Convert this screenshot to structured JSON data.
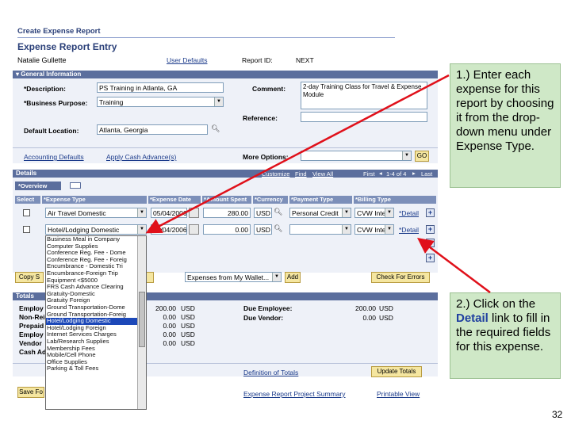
{
  "header": {
    "create_link": "Create Expense Report",
    "title": "Expense Report Entry",
    "user_name": "Natalie Gullette",
    "user_defaults": "User Defaults",
    "report_id_label": "Report ID:",
    "report_id_value": "NEXT"
  },
  "general": {
    "section_title": "General Information",
    "description_label": "*Description:",
    "description_value": "PS Training in Atlanta, GA",
    "purpose_label": "*Business Purpose:",
    "purpose_value": "Training",
    "comment_label": "Comment:",
    "comment_value": "2-day Training Class for Travel & Expense Module",
    "reference_label": "Reference:",
    "location_label": "Default Location:",
    "location_value": "Atlanta, Georgia",
    "accounting_defaults": "Accounting Defaults",
    "apply_cash_advance": "Apply Cash Advance(s)",
    "more_options_label": "More Options:",
    "go_button": "GO"
  },
  "details": {
    "section_title": "Details",
    "customize": "Customize",
    "find": "Find",
    "view_all": "View All",
    "first": "First",
    "range": "1-4 of 4",
    "last": "Last",
    "tab_overview": "*Overview",
    "columns": [
      "Select",
      "*Expense Type",
      "*Expense Date",
      "*Amount Spent",
      "*Currency",
      "*Payment Type",
      "*Billing Type"
    ],
    "rows": [
      {
        "type": "Air Travel Domestic",
        "date": "05/04/2006",
        "amount": "280.00",
        "currency": "USD",
        "payment": "Personal Credit",
        "billing": "CVW Inte",
        "detail": "*Detail"
      },
      {
        "type": "Hotel/Lodging Domestic",
        "date": "05/04/2006",
        "amount": "0.00",
        "currency": "USD",
        "payment": "",
        "billing": "CVW Inte",
        "detail": "*Detail"
      }
    ],
    "copy_selected": "Copy S",
    "wallet_select": "Expenses from My Wallet...",
    "add_button": "Add",
    "check_errors": "Check For Errors"
  },
  "dropdown": {
    "items": [
      "Business Meal in Company",
      "Computer Supplies",
      "Conference Reg. Fee - Dome",
      "Conference Reg. Fee - Foreig",
      "Encumbrance - Domestic Tri",
      "Encumbrance-Foreign Trip",
      "Equipment <$5000",
      "FRS Cash Advance Clearing",
      "Gratuity-Domestic",
      "Gratuity Foreign",
      "Ground Transportation-Dome",
      "Ground Transportation-Foreig",
      "Hotel/Lodging Domestic",
      "Hotel/Lodging Foreign",
      "Internet Services Charges",
      "Lab/Research Supplies",
      "Membership Fees",
      "Mobile/Cell Phone",
      "Office Supplies",
      "Parking & Toll Fees"
    ],
    "selected_index": 12
  },
  "totals": {
    "section_title": "Totals",
    "left_labels": [
      "Employ",
      "Non-Rei",
      "Prepaid",
      "Employ",
      "Vendor",
      "Cash Ad"
    ],
    "left_values": [
      "200.00",
      "0.00",
      "0.00",
      "0.00",
      "0.00"
    ],
    "currency": "USD",
    "due_employee_label": "Due Employee:",
    "due_employee_value": "200.00",
    "due_vendor_label": "Due Vendor:",
    "due_vendor_value": "0.00",
    "definition_link": "Definition of Totals",
    "update_totals": "Update Totals"
  },
  "footer": {
    "save_for_later": "Save Fo",
    "project_summary": "Expense Report Project Summary",
    "printable_view": "Printable View"
  },
  "callouts": {
    "one": "1.) Enter each expense for this report by choosing it from the drop-down menu under Expense Type.",
    "two_prefix": "2.) Click on the",
    "two_detail": "Detail",
    "two_suffix": "link to fill in the required fields for this expense."
  },
  "slide_number": "32",
  "colors": {
    "arrow": "#e0101a",
    "callout_bg": "#cfe8c7",
    "section_bar": "#5b6e9d",
    "selected_item": "#1c48b8"
  }
}
